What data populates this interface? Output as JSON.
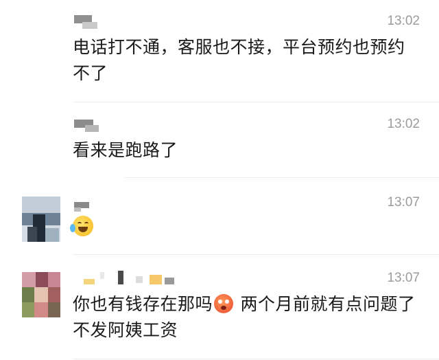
{
  "messages": [
    {
      "time": "13:02",
      "text": "电话打不通，客服也不接，平台预约也预约不了"
    },
    {
      "time": "13:02",
      "text": "看来是跑路了"
    },
    {
      "time": "13:07",
      "emoji": "face-with-tears-of-joy-emoji"
    },
    {
      "time": "13:07",
      "text_before": "你也有钱存在那吗",
      "emoji": "anguished-face-emoji",
      "text_after": " 两个月前就有点问题了 不发阿姨工资"
    }
  ],
  "colors": {
    "text": "#191919",
    "time": "#9b9b9b",
    "divider": "#ececec"
  }
}
